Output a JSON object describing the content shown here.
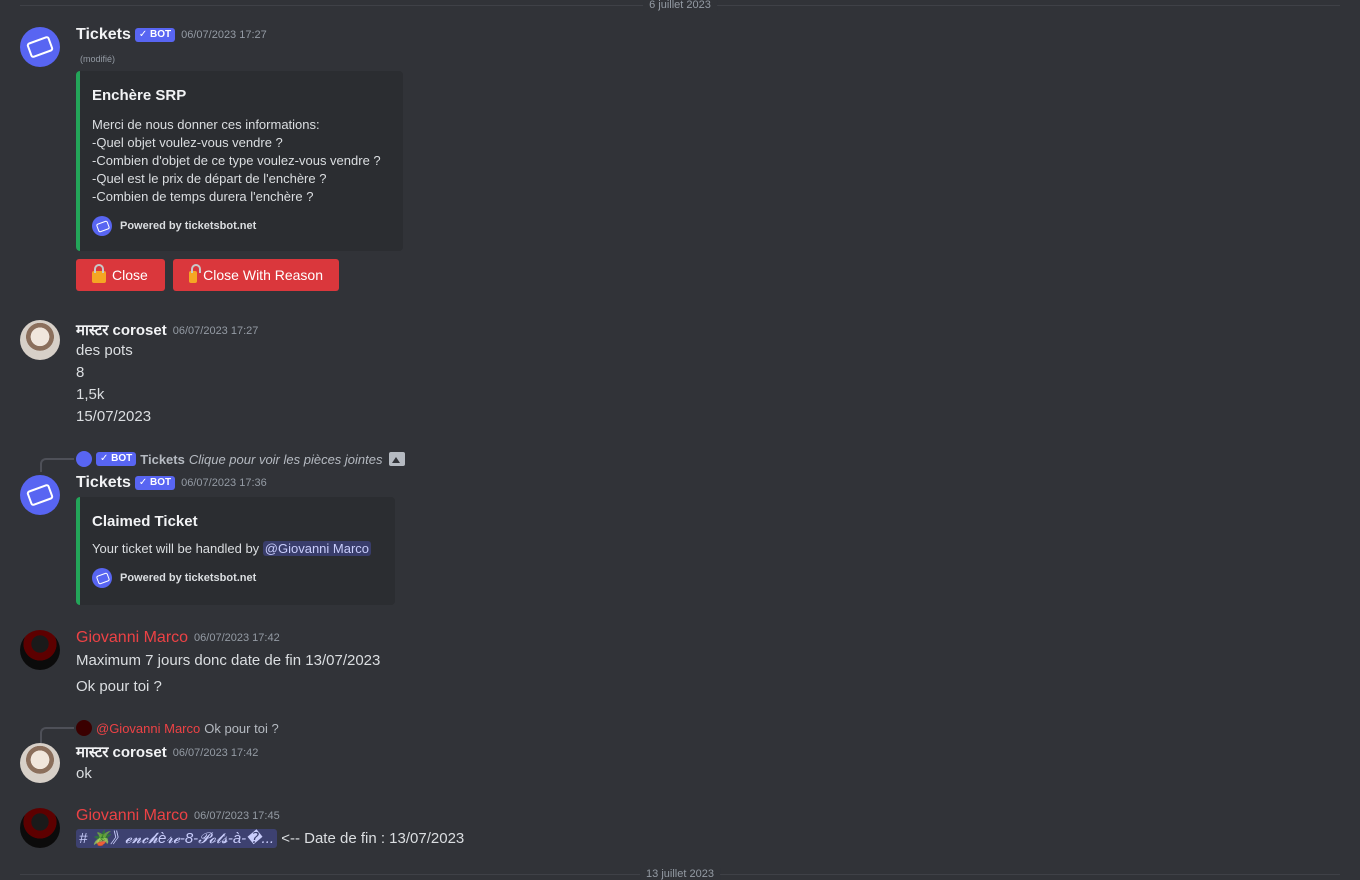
{
  "dividers": {
    "top": "6 juillet 2023",
    "bottom": "13 juillet 2023"
  },
  "bot_tag": "✓ BOT",
  "messages": {
    "m1": {
      "author": "Tickets",
      "timestamp": "06/07/2023 17:27",
      "edited": "(modifié)",
      "embed": {
        "title": "Enchère SRP",
        "lines": [
          "Merci de nous donner ces informations:",
          "-Quel objet voulez-vous vendre ?",
          "-Combien d'objet de ce type voulez-vous vendre ?",
          "-Quel est le prix de départ de l'enchère ?",
          "-Combien de temps durera l'enchère ?"
        ],
        "footer": "Powered by ticketsbot.net"
      },
      "buttons": {
        "close": "Close",
        "close_reason": "Close With Reason"
      }
    },
    "m2": {
      "author": "मास्टर coroset",
      "timestamp": "06/07/2023 17:27",
      "lines": [
        "des pots",
        "8",
        "1,5k",
        "15/07/2023"
      ]
    },
    "m3": {
      "reply": {
        "author": "Tickets",
        "text": "Clique pour voir les pièces jointes"
      },
      "author": "Tickets",
      "timestamp": "06/07/2023 17:36",
      "embed": {
        "title": "Claimed Ticket",
        "desc_prefix": "Your ticket will be handled by ",
        "mention": "@Giovanni Marco",
        "footer": "Powered by ticketsbot.net"
      }
    },
    "m4": {
      "author": "Giovanni Marco",
      "timestamp": "06/07/2023 17:42",
      "lines": [
        "Maximum 7 jours donc date de fin 13/07/2023",
        "Ok pour toi ?"
      ]
    },
    "m5": {
      "reply": {
        "author": "@Giovanni Marco",
        "text": "Ok pour toi ?"
      },
      "author": "मास्टर coroset",
      "timestamp": "06/07/2023 17:42",
      "text": "ok"
    },
    "m6": {
      "author": "Giovanni Marco",
      "timestamp": "06/07/2023 17:45",
      "channel": "# 🪴》𝓮𝓷𝓬𝓱è𝓻𝓮-8-𝓟𝓸𝓽𝓼-à-�...",
      "text": " <-- Date de fin : 13/07/2023"
    }
  },
  "colors": {
    "accent": "#5865f2",
    "embed_border": "#23a559",
    "danger": "#da373c",
    "gio_name": "#ed4245"
  }
}
